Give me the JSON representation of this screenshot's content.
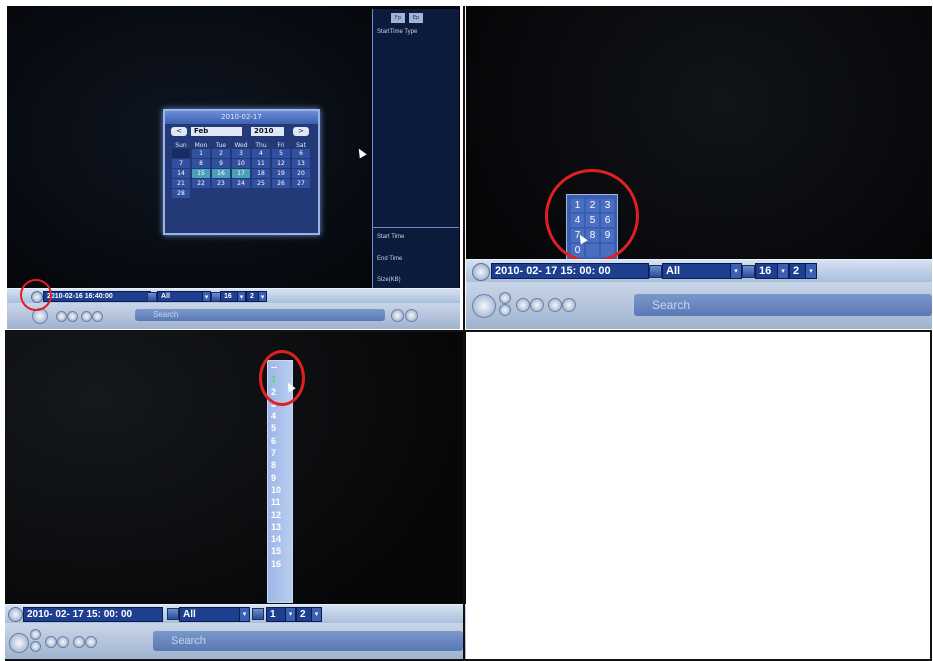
{
  "panel1": {
    "calendar": {
      "title": "2010-02-17",
      "prev": "<",
      "month": "Feb",
      "year": "2010",
      "next": ">",
      "weekdays": [
        "Sun",
        "Mon",
        "Tue",
        "Wed",
        "Thu",
        "Fri",
        "Sat"
      ],
      "days": [
        "",
        "1",
        "2",
        "3",
        "4",
        "5",
        "6",
        "7",
        "8",
        "9",
        "10",
        "11",
        "12",
        "13",
        "14",
        "15",
        "16",
        "17",
        "18",
        "19",
        "20",
        "21",
        "22",
        "23",
        "24",
        "25",
        "26",
        "27",
        "28"
      ]
    },
    "sidebar": {
      "tab1": "Fp",
      "tab2": "Ep",
      "header": "StartTime Type",
      "start_time": "Start Time",
      "end_time": "End Time",
      "size": "Size(KB)"
    },
    "bar": {
      "datetime": "2010-02-16 16:40:00",
      "type": "All",
      "count": "16",
      "channel": "2"
    },
    "search_label": "Search"
  },
  "panel2": {
    "keypad": [
      "1",
      "2",
      "3",
      "4",
      "5",
      "6",
      "7",
      "8",
      "9",
      "0",
      "",
      ""
    ],
    "bar": {
      "datetime": "2010- 02- 17  15: 00: 00",
      "type": "All",
      "count": "16",
      "channel": "2"
    },
    "search_label": "Search"
  },
  "panel3": {
    "channel_list": [
      "--",
      "1",
      "2",
      "3",
      "4",
      "5",
      "6",
      "7",
      "8",
      "9",
      "10",
      "11",
      "12",
      "13",
      "14",
      "15",
      "16"
    ],
    "bar": {
      "datetime": "2010- 02- 17  15: 00: 00",
      "type": "All",
      "count": "1",
      "channel": "2"
    },
    "search_label": "Search"
  },
  "colors": {
    "highlight_circle": "#e02020",
    "bar_blue": "#1e3f8f",
    "selected_day": "#4aa0b8"
  }
}
